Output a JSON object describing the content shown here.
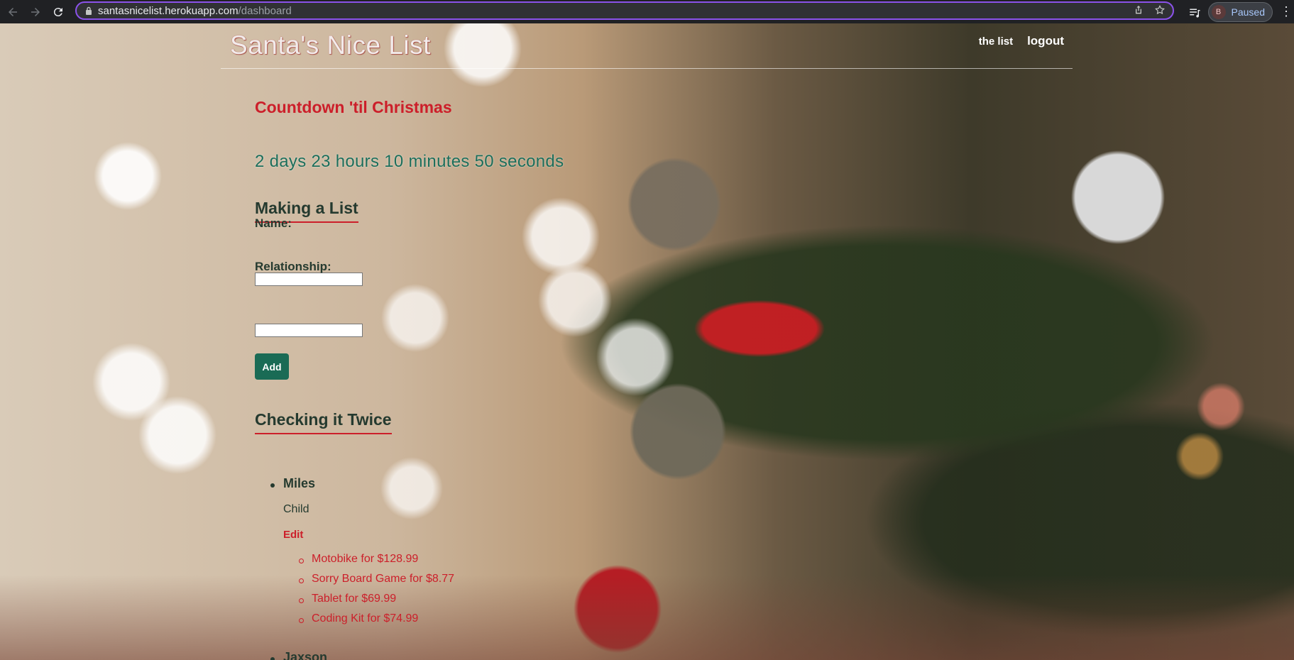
{
  "browser": {
    "url_host": "santasnicelist.herokuapp.com",
    "url_path": "/dashboard",
    "profile_initial": "B",
    "profile_status": "Paused"
  },
  "header": {
    "title": "Santa's Nice List",
    "nav": [
      "the list",
      "logout"
    ]
  },
  "countdown": {
    "title": "Countdown 'til Christmas",
    "value": "2 days 23 hours 10 minutes 50 seconds"
  },
  "form": {
    "title": "Making a List",
    "name_label": "Name:",
    "name_value": "",
    "relationship_label": "Relationship:",
    "relationship_value": "",
    "submit_label": "Add"
  },
  "list": {
    "title": "Checking it Twice",
    "people": [
      {
        "name": "Miles",
        "relationship": "Child",
        "edit_label": "Edit",
        "gifts": [
          "Motobike for $128.99",
          "Sorry Board Game for $8.77",
          "Tablet for $69.99",
          "Coding Kit for $74.99"
        ]
      },
      {
        "name": "Jaxson"
      }
    ]
  },
  "colors": {
    "accent_red": "#cc1f2a",
    "accent_green": "#1a6b55",
    "text_dark": "#253a2f",
    "url_focus": "#8b52ea"
  }
}
